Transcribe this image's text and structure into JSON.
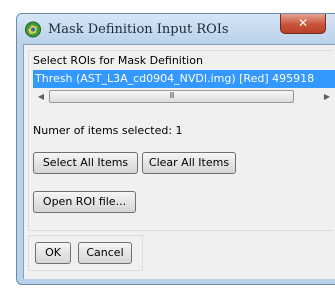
{
  "window": {
    "title": "Mask Definition Input ROIs",
    "close_glyph": "✕"
  },
  "icons": {
    "app": "envi-app-icon",
    "close": "close-icon",
    "scroll_left": "scroll-left-arrow-icon",
    "scroll_right": "scroll-right-arrow-icon",
    "thumb_grip": "scroll-grip-icon"
  },
  "glyphs": {
    "scroll_left": "◀",
    "scroll_right": "▶",
    "thumb_grip": "III"
  },
  "roi_list": {
    "label": "Select ROIs for Mask Definition",
    "items": [
      "Thresh (AST_L3A_cd0904_NVDI.img) [Red] 495918"
    ]
  },
  "status": {
    "selected_count_text": "Numer of items selected: 1"
  },
  "buttons": {
    "select_all": "Select All Items",
    "clear_all": "Clear All Items",
    "open_roi_file": "Open ROI file...",
    "ok": "OK",
    "cancel": "Cancel"
  },
  "colors": {
    "selection": "#3399ff",
    "close_button": "#c9543b",
    "frame": "#b9d1ea"
  }
}
